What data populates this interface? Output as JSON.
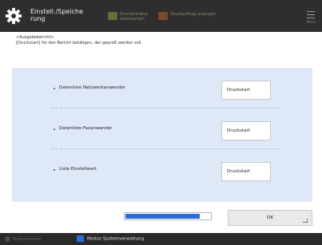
{
  "header": {
    "title": "Einstell./Speiche rung",
    "btn1": "Druckerstatus überwachen",
    "btn2": "Druckauftrag anzeigen",
    "menu_label": "Menü"
  },
  "instruction": {
    "line1": "<Ausgabebericht>",
    "line2": "[Druckstart] für den Bericht betätigen, der geprüft werden soll."
  },
  "rows": [
    {
      "label": "Datenliste Netzwerkanwender",
      "button": "Druckstart"
    },
    {
      "label": "Datenliste Faxanwender",
      "button": "Druckstart"
    },
    {
      "label": "Liste Einstellwert",
      "button": "Druckstart"
    }
  ],
  "progress": {
    "value": 0.88
  },
  "ok_button": "OK",
  "footer": {
    "status": "Statusmonitor",
    "mode": "Modus Systemverwaltung"
  },
  "colors": {
    "accent": "#2a6cd8",
    "panel": "#dfe8f6"
  }
}
